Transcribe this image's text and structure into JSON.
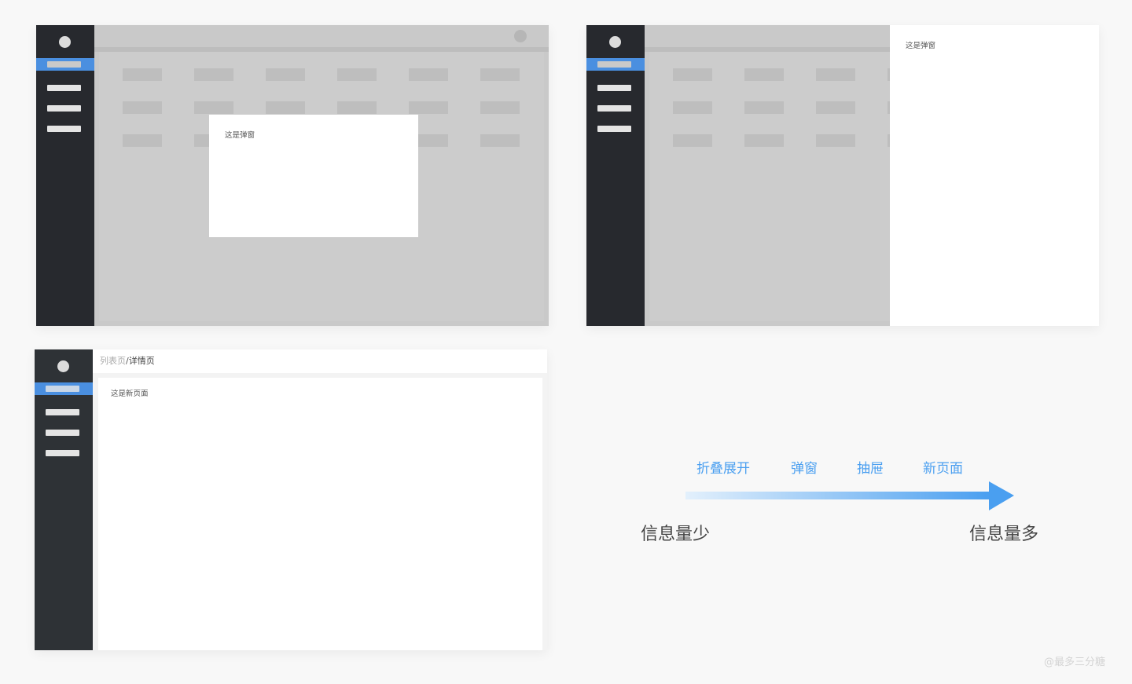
{
  "panel_modal": {
    "modal_text": "这是弹窗"
  },
  "panel_drawer": {
    "drawer_text": "这是弹窗"
  },
  "panel_newpage": {
    "breadcrumb_parent": "列表页",
    "breadcrumb_separator": "/",
    "breadcrumb_current": "详情页",
    "content_text": "这是新页面"
  },
  "scale": {
    "options": [
      "折叠展开",
      "弹窗",
      "抽屉",
      "新页面"
    ],
    "left_label": "信息量少",
    "right_label": "信息量多"
  },
  "watermark": "@最多三分糖",
  "colors": {
    "sidebar": "#27292e",
    "accent": "#4a8fe0",
    "overlay_grey": "#c9c9c9",
    "label_blue": "#4a9ff0",
    "arrow_start": "#e3f0fc",
    "arrow_end": "#4a9ff0"
  },
  "icons": {
    "arrow": "arrow-right-icon",
    "avatar": "avatar-circle"
  }
}
